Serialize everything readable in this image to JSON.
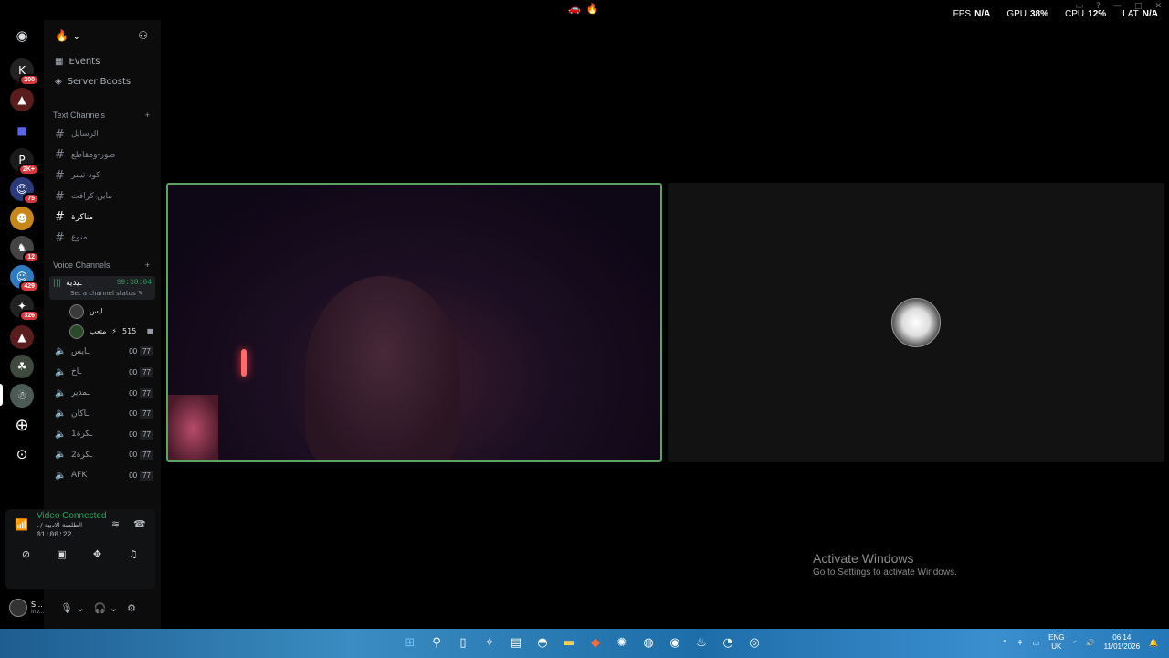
{
  "titlebar": {
    "stats": [
      {
        "label": "FPS",
        "value": "N/A"
      },
      {
        "label": "GPU",
        "value": "38%"
      },
      {
        "label": "CPU",
        "value": "12%"
      },
      {
        "label": "LAT",
        "value": "N/A"
      }
    ]
  },
  "rail": {
    "servers": [
      {
        "badge": "200"
      },
      {
        "badge": ""
      },
      {
        "badge": ""
      },
      {
        "badge": "2K+"
      },
      {
        "badge": "75"
      },
      {
        "badge": ""
      },
      {
        "badge": "12"
      },
      {
        "badge": "429"
      },
      {
        "badge": "326"
      },
      {
        "badge": ""
      },
      {
        "badge": ""
      },
      {
        "badge": ""
      }
    ]
  },
  "sidebar": {
    "events": "Events",
    "boosts": "Server Boosts",
    "text_category": "Text Channels",
    "text_channels": [
      "الرسايل",
      "صور-ومقاطع",
      "كود-تيمر",
      "ماين-كرافت",
      "مناكرة",
      "منوع"
    ],
    "voice_category": "Voice Channels",
    "current_voice": {
      "name": "ـيدية",
      "time": "39:38:04",
      "status": "Set a channel status"
    },
    "members": [
      {
        "name": "ايس",
        "extra": ""
      },
      {
        "name": "متعب",
        "extra": "515"
      }
    ],
    "voice_channels": [
      {
        "name": "ـايس",
        "a": "00",
        "b": "77"
      },
      {
        "name": "ـاخ",
        "a": "00",
        "b": "77"
      },
      {
        "name": "ـمدير",
        "a": "00",
        "b": "77"
      },
      {
        "name": "ـاكان",
        "a": "00",
        "b": "77"
      },
      {
        "name": "1ـكرة",
        "a": "00",
        "b": "77"
      },
      {
        "name": "2ـكرة",
        "a": "00",
        "b": "77"
      },
      {
        "name": "AFK",
        "a": "00",
        "b": "77"
      }
    ]
  },
  "voice_panel": {
    "title": "Video Connected",
    "subtitle": "الطلسة الادبية / ـ",
    "time": "01:06:22"
  },
  "user": {
    "name": "S...",
    "status": "Inv..."
  },
  "watermark": {
    "line1": "Activate Windows",
    "line2": "Go to Settings to activate Windows."
  },
  "tray": {
    "lang1": "ENG",
    "lang2": "UK",
    "time": "06:14",
    "date": "11/01/2026"
  }
}
